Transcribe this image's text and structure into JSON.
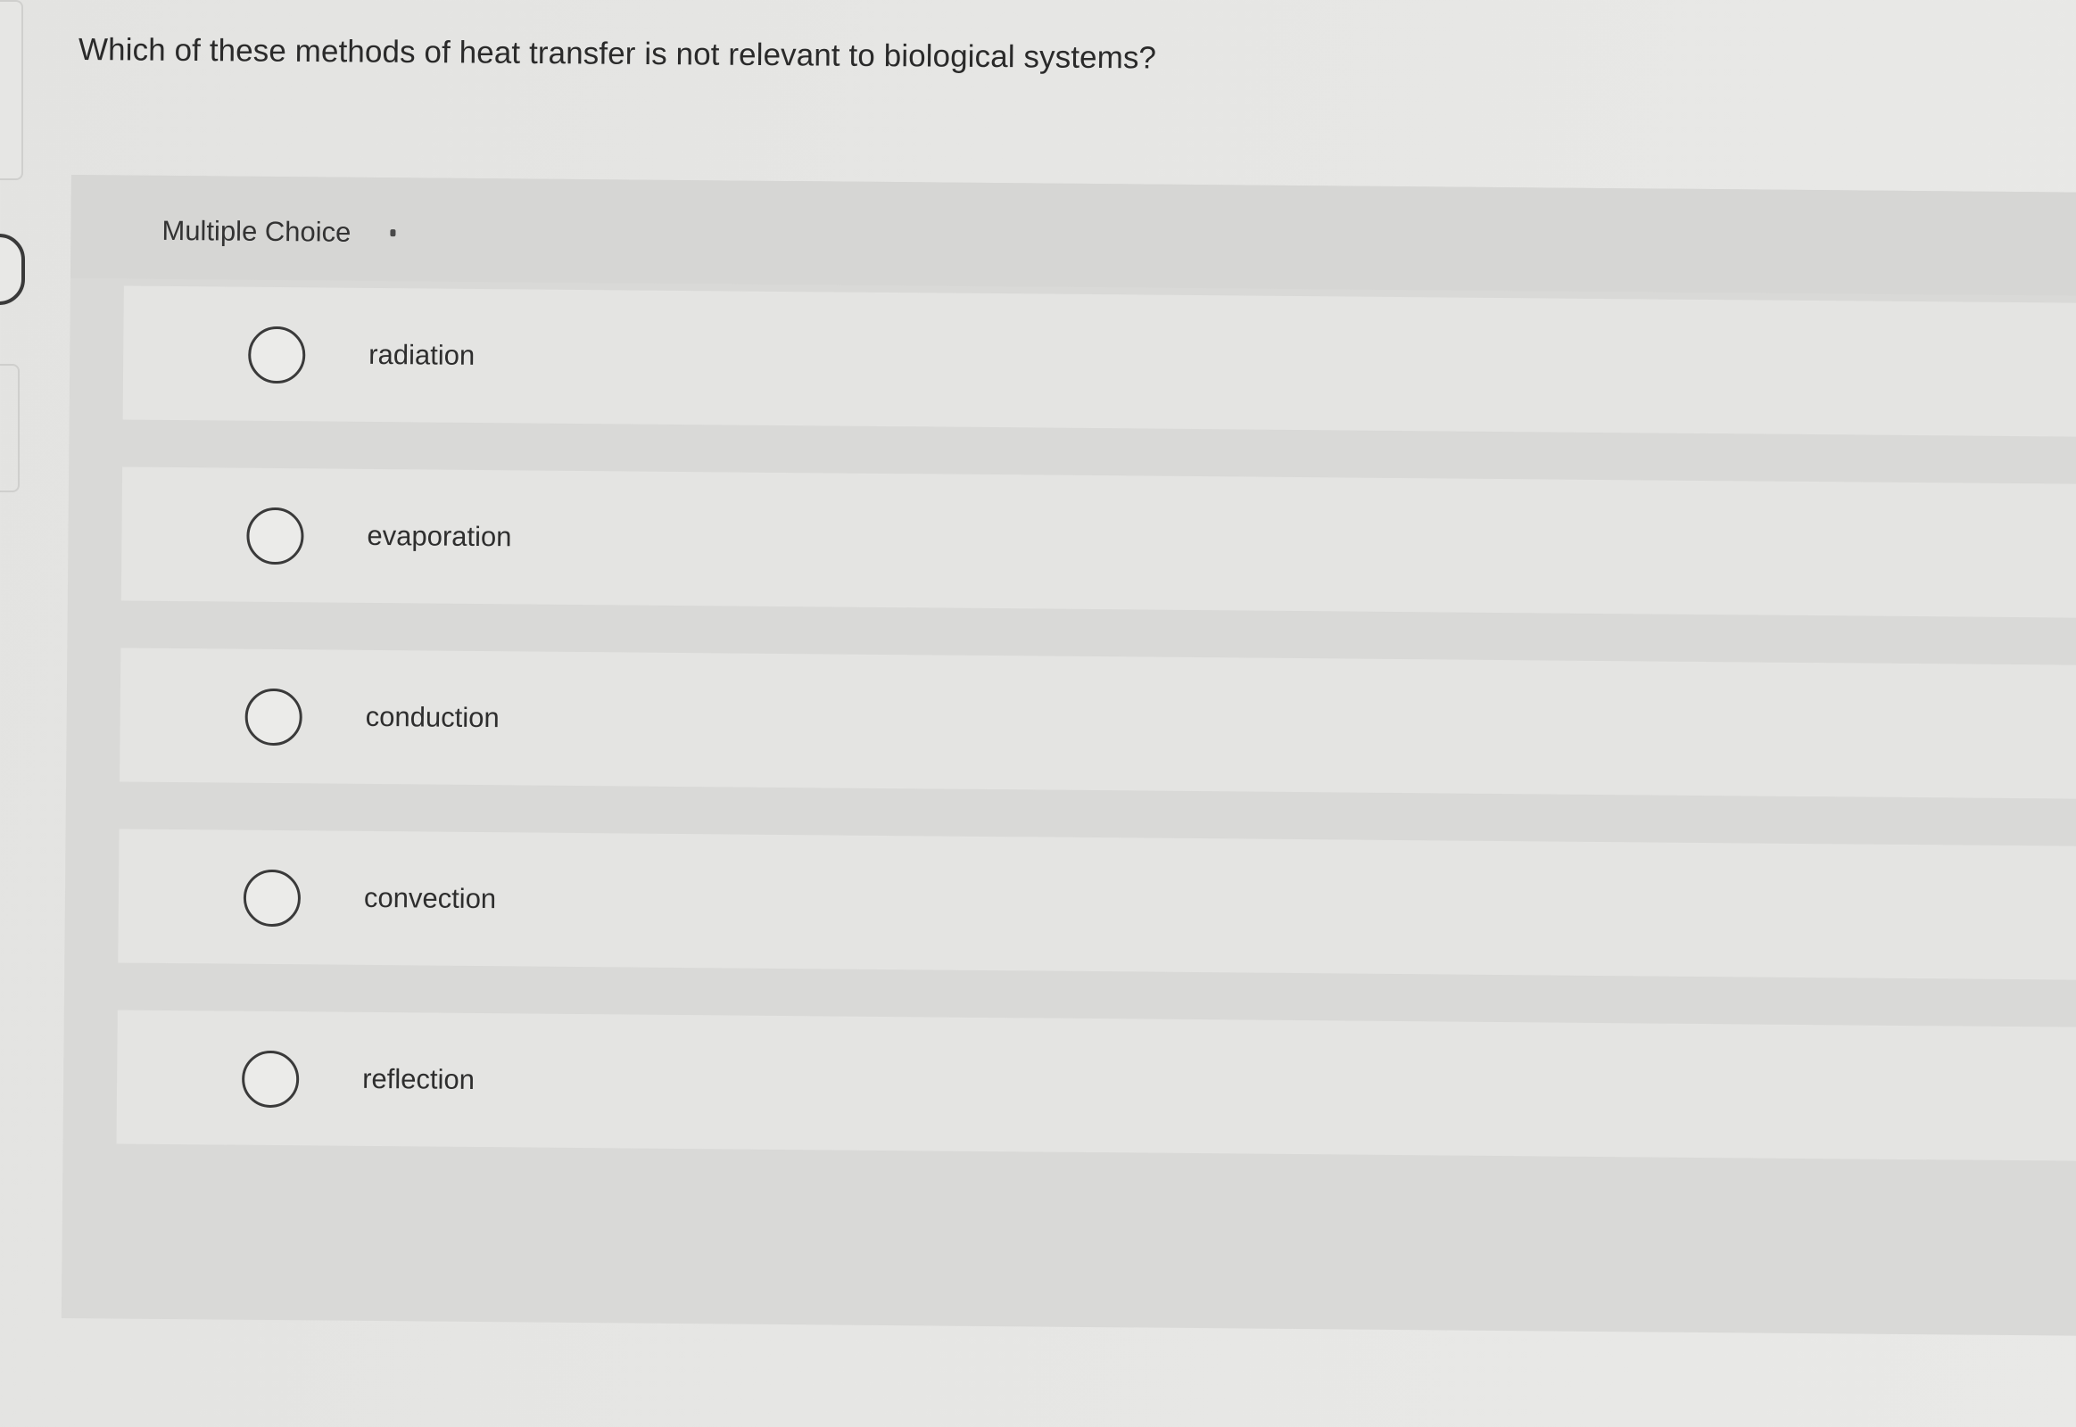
{
  "question": {
    "text": "Which of these methods of heat transfer is not relevant to biological systems?"
  },
  "card": {
    "type_label": "Multiple Choice"
  },
  "choices": [
    {
      "label": "radiation"
    },
    {
      "label": "evaporation"
    },
    {
      "label": "conduction"
    },
    {
      "label": "convection"
    },
    {
      "label": "reflection"
    }
  ],
  "colors": {
    "background": "#e6e6e4",
    "card": "#d9d9d7",
    "choice_row": "#e4e4e2",
    "radio_border": "#3a3a3a",
    "text": "#2b2b2b"
  }
}
